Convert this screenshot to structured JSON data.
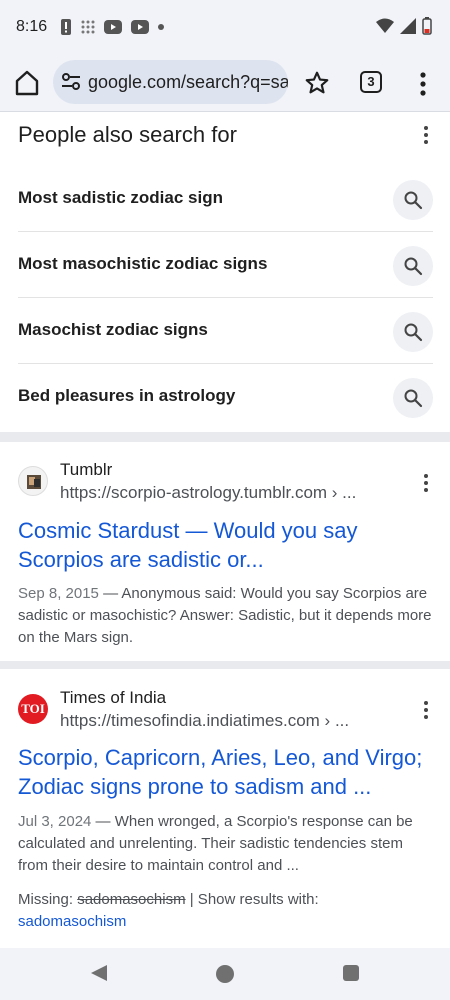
{
  "status_bar": {
    "time": "8:16",
    "left_icons": [
      "alert-icon",
      "grid-icon",
      "youtube-icon",
      "youtube-icon",
      "dot-icon"
    ],
    "right_icons": [
      "wifi-icon",
      "signal-icon",
      "battery-low-icon"
    ]
  },
  "toolbar": {
    "url": "google.com/search?q=sa",
    "tab_count": "3"
  },
  "people_also_search": {
    "title": "People also search for",
    "items": [
      {
        "label": "Most sadistic zodiac sign"
      },
      {
        "label": "Most masochistic zodiac signs"
      },
      {
        "label": "Masochist zodiac signs"
      },
      {
        "label": "Bed pleasures in astrology"
      }
    ]
  },
  "results": [
    {
      "site_name": "Tumblr",
      "url": "https://scorpio-astrology.tumblr.com › ...",
      "title": "Cosmic Stardust — Would you say Scorpios are sadistic or...",
      "date": "Sep 8, 2015",
      "snippet": " — Anonymous said: Would you say Scorpios are sadistic or masochistic? Answer: Sadistic, but it depends more on the Mars sign."
    },
    {
      "site_name": "Times of India",
      "favicon_text": "TOI",
      "url": "https://timesofindia.indiatimes.com › ...",
      "title": "Scorpio, Capricorn, Aries, Leo, and Virgo; Zodiac signs prone to sadism and ...",
      "date": "Jul 3, 2024",
      "snippet": " — When wronged, a Scorpio's response can be calculated and unrelenting. Their sadistic tendencies stem from their desire to maintain control and ...",
      "missing_label": "Missing: ",
      "missing_term": "sadomasochism",
      "show_results_label": " | Show results with:",
      "show_results_term": "sadomasochism"
    }
  ],
  "colors": {
    "link": "#1558d6",
    "chrome_bg": "#f1f3f8",
    "toi_red": "#e21b22"
  }
}
